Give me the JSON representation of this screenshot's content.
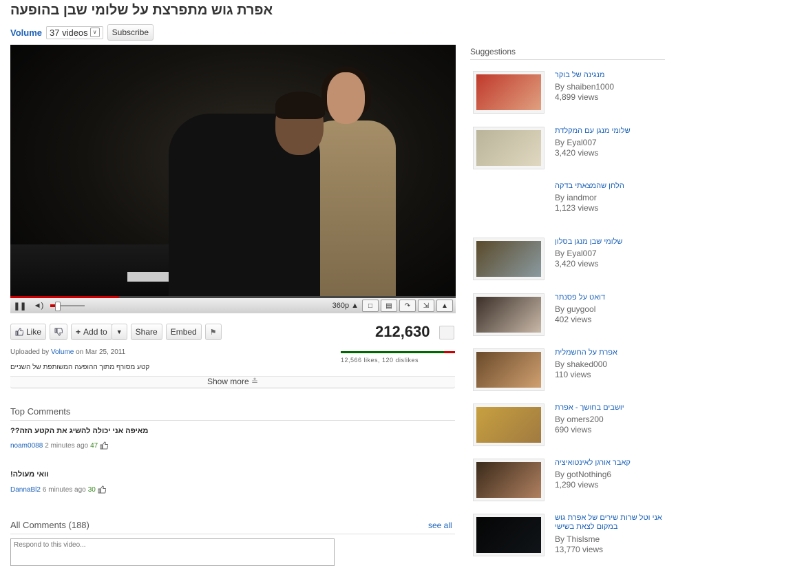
{
  "video": {
    "title": "אפרת גוש מתפרצת על שלומי שבן בהופעה",
    "channel": "Volume",
    "video_count": "37 videos",
    "subscribe_label": "Subscribe",
    "quality": "360p",
    "view_count": "212,630",
    "uploaded_prefix": "Uploaded by",
    "uploader": "Volume",
    "uploaded_suffix": "on Mar 25, 2011",
    "description": "קטע מסורף מתוך ההופעה המשותפת של השניים",
    "likes_text": "12,566 likes, 120 dislikes",
    "like_ratio": 0.99,
    "progress_fraction": 0.244,
    "volume_fraction": 0.2,
    "show_more": "Show more"
  },
  "actions": {
    "like": "Like",
    "add_to": "Add to",
    "share": "Share",
    "embed": "Embed"
  },
  "comments": {
    "top_title": "Top Comments",
    "top": [
      {
        "text": "מאיפה אני יכולה להשיג את הקטע הזה??",
        "user": "noam0088",
        "time": "2 minutes ago",
        "score": "47"
      },
      {
        "text": "וואי מעולה!",
        "user": "DannaBl2",
        "time": "6 minutes ago",
        "score": "30"
      }
    ],
    "all_title": "All Comments (188)",
    "see_all": "see all",
    "placeholder": "Respond to this video..."
  },
  "suggestions": {
    "title": "Suggestions",
    "by_label": "By",
    "items": [
      {
        "title": "מנגינה של בוקר",
        "author": "By shaiben1000",
        "views": "4,899 views",
        "colors": [
          "#c0392b",
          "#e0a080"
        ]
      },
      {
        "title": "שלומי מנגן עם המקלדת",
        "author": "By Eyal007",
        "views": "3,420 views",
        "colors": [
          "#b9b49a",
          "#e0d8c0"
        ]
      },
      {
        "title": "הלחן שהמצאתי בדקה",
        "author": "By iandmor",
        "views": "1,123 views",
        "colors": []
      },
      {
        "title": "שלומי שבן מנגן בסלון",
        "author": "By Eyal007",
        "views": "3,420 views",
        "colors": [
          "#5a4a2a",
          "#8a9aa0"
        ]
      },
      {
        "title": "דואט על פסנתר",
        "author": "By guygool",
        "views": "402 views",
        "colors": [
          "#3a2f28",
          "#c8b8a8"
        ]
      },
      {
        "title": "אפרת על החשמלית",
        "author": "By shaked000",
        "views": "110 views",
        "colors": [
          "#6a4a2a",
          "#d0a070"
        ]
      },
      {
        "title": "יושבים בחושך - אפרת",
        "author": "By omers200",
        "views": "690 views",
        "colors": [
          "#c8a040",
          "#a07a40"
        ]
      },
      {
        "title": "קאבר אורגן לאינטואיציה",
        "author": "By gotNothing6",
        "views": "1,290 views",
        "colors": [
          "#3a2a1a",
          "#b08060"
        ]
      },
      {
        "title": "אני וטל שרות שירים של אפרת גוש במקום לצאת בשישי",
        "author": "By Thislsme",
        "views": "13,770 views",
        "colors": [
          "#050505",
          "#101418"
        ]
      }
    ]
  }
}
